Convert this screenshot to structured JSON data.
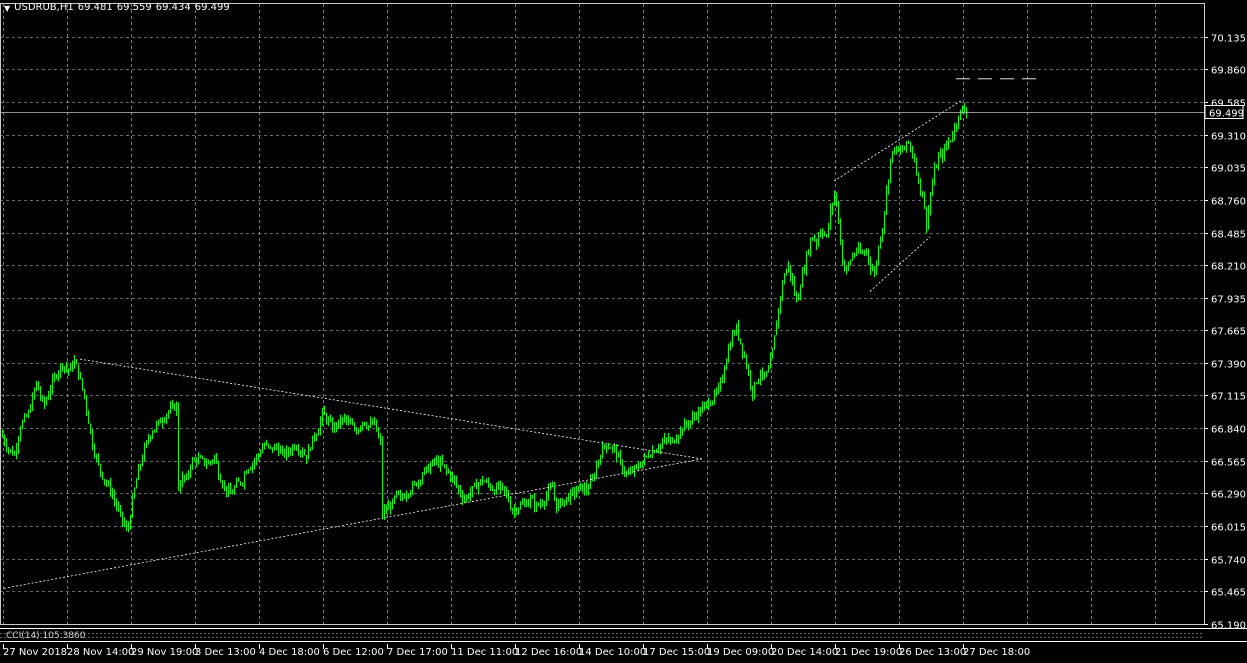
{
  "header": {
    "symbol": "USDRUB,H1",
    "open": "69.481",
    "high": "69.559",
    "low": "69.434",
    "close": "69.499"
  },
  "current_price": "69.499",
  "indicator_label": "CCI(14) 105.3860",
  "colors": {
    "background": "#000000",
    "grid": "#c8c8c8",
    "candle": "#00ff00",
    "price_line": "#c0c0c0",
    "trendline": "#ffffff",
    "text": "#ffffff"
  },
  "chart_data": {
    "type": "candlestick",
    "symbol": "USDRUB",
    "timeframe": "H1",
    "ylim": [
      65.19,
      70.41
    ],
    "y_ticks": [
      "70.135",
      "69.860",
      "69.585",
      "69.310",
      "69.035",
      "68.760",
      "68.485",
      "68.210",
      "67.935",
      "67.665",
      "67.390",
      "67.115",
      "66.840",
      "66.565",
      "66.290",
      "66.015",
      "65.740",
      "65.465",
      "65.190"
    ],
    "x_ticks": [
      "27 Nov 2018",
      "28 Nov 14:00",
      "29 Nov 19:00",
      "3 Dec 13:00",
      "4 Dec 18:00",
      "6 Dec 12:00",
      "7 Dec 17:00",
      "11 Dec 11:00",
      "12 Dec 16:00",
      "14 Dec 10:00",
      "17 Dec 15:00",
      "19 Dec 09:00",
      "20 Dec 14:00",
      "21 Dec 19:00",
      "26 Dec 13:00",
      "27 Dec 18:00"
    ],
    "grid": true,
    "close_path": [
      [
        0,
        66.8
      ],
      [
        8,
        66.66
      ],
      [
        14,
        66.62
      ],
      [
        20,
        66.86
      ],
      [
        28,
        66.96
      ],
      [
        36,
        67.22
      ],
      [
        43,
        67.02
      ],
      [
        50,
        67.18
      ],
      [
        56,
        67.3
      ],
      [
        62,
        67.38
      ],
      [
        68,
        67.32
      ],
      [
        74,
        67.4
      ],
      [
        78,
        67.3
      ],
      [
        84,
        67.1
      ],
      [
        88,
        66.9
      ],
      [
        92,
        66.7
      ],
      [
        98,
        66.52
      ],
      [
        104,
        66.4
      ],
      [
        110,
        66.32
      ],
      [
        116,
        66.18
      ],
      [
        122,
        66.06
      ],
      [
        127,
        65.96
      ],
      [
        130,
        66.12
      ],
      [
        134,
        66.32
      ],
      [
        138,
        66.48
      ],
      [
        144,
        66.66
      ],
      [
        150,
        66.8
      ],
      [
        156,
        66.86
      ],
      [
        162,
        66.92
      ],
      [
        168,
        66.98
      ],
      [
        174,
        67.02
      ],
      [
        178,
        66.34
      ],
      [
        182,
        66.42
      ],
      [
        186,
        66.4
      ],
      [
        190,
        66.54
      ],
      [
        196,
        66.58
      ],
      [
        202,
        66.56
      ],
      [
        208,
        66.54
      ],
      [
        214,
        66.6
      ],
      [
        218,
        66.46
      ],
      [
        224,
        66.34
      ],
      [
        230,
        66.28
      ],
      [
        236,
        66.36
      ],
      [
        242,
        66.4
      ],
      [
        246,
        66.5
      ],
      [
        252,
        66.54
      ],
      [
        258,
        66.62
      ],
      [
        264,
        66.7
      ],
      [
        270,
        66.66
      ],
      [
        276,
        66.68
      ],
      [
        282,
        66.62
      ],
      [
        288,
        66.64
      ],
      [
        294,
        66.7
      ],
      [
        300,
        66.66
      ],
      [
        306,
        66.6
      ],
      [
        312,
        66.74
      ],
      [
        318,
        66.84
      ],
      [
        322,
        66.96
      ],
      [
        326,
        66.92
      ],
      [
        332,
        66.84
      ],
      [
        338,
        66.88
      ],
      [
        344,
        66.92
      ],
      [
        350,
        66.86
      ],
      [
        356,
        66.82
      ],
      [
        362,
        66.9
      ],
      [
        368,
        66.86
      ],
      [
        374,
        66.88
      ],
      [
        379,
        66.72
      ],
      [
        381,
        66.1
      ],
      [
        386,
        66.16
      ],
      [
        392,
        66.2
      ],
      [
        396,
        66.28
      ],
      [
        400,
        66.24
      ],
      [
        406,
        66.3
      ],
      [
        412,
        66.34
      ],
      [
        418,
        66.4
      ],
      [
        422,
        66.46
      ],
      [
        428,
        66.5
      ],
      [
        434,
        66.56
      ],
      [
        440,
        66.54
      ],
      [
        446,
        66.48
      ],
      [
        452,
        66.42
      ],
      [
        458,
        66.32
      ],
      [
        464,
        66.24
      ],
      [
        470,
        66.3
      ],
      [
        476,
        66.36
      ],
      [
        482,
        66.4
      ],
      [
        488,
        66.36
      ],
      [
        494,
        66.32
      ],
      [
        500,
        66.34
      ],
      [
        506,
        66.28
      ],
      [
        512,
        66.14
      ],
      [
        518,
        66.18
      ],
      [
        524,
        66.2
      ],
      [
        530,
        66.24
      ],
      [
        536,
        66.18
      ],
      [
        542,
        66.22
      ],
      [
        548,
        66.3
      ],
      [
        552,
        66.34
      ],
      [
        556,
        66.18
      ],
      [
        562,
        66.22
      ],
      [
        568,
        66.26
      ],
      [
        574,
        66.3
      ],
      [
        580,
        66.34
      ],
      [
        586,
        66.32
      ],
      [
        592,
        66.4
      ],
      [
        598,
        66.58
      ],
      [
        604,
        66.7
      ],
      [
        610,
        66.68
      ],
      [
        614,
        66.66
      ],
      [
        618,
        66.58
      ],
      [
        622,
        66.5
      ],
      [
        628,
        66.44
      ],
      [
        632,
        66.48
      ],
      [
        636,
        66.5
      ],
      [
        642,
        66.56
      ],
      [
        648,
        66.62
      ],
      [
        654,
        66.66
      ],
      [
        660,
        66.7
      ],
      [
        666,
        66.74
      ],
      [
        672,
        66.72
      ],
      [
        678,
        66.8
      ],
      [
        684,
        66.86
      ],
      [
        690,
        66.9
      ],
      [
        696,
        66.96
      ],
      [
        702,
        67.0
      ],
      [
        708,
        67.06
      ],
      [
        714,
        67.1
      ],
      [
        720,
        67.2
      ],
      [
        726,
        67.44
      ],
      [
        732,
        67.62
      ],
      [
        736,
        67.68
      ],
      [
        740,
        67.56
      ],
      [
        744,
        67.44
      ],
      [
        748,
        67.3
      ],
      [
        752,
        67.14
      ],
      [
        756,
        67.24
      ],
      [
        760,
        67.3
      ],
      [
        764,
        67.26
      ],
      [
        768,
        67.32
      ],
      [
        772,
        67.48
      ],
      [
        776,
        67.72
      ],
      [
        780,
        67.96
      ],
      [
        784,
        68.14
      ],
      [
        788,
        68.2
      ],
      [
        792,
        68.06
      ],
      [
        796,
        67.9
      ],
      [
        800,
        68.06
      ],
      [
        804,
        68.2
      ],
      [
        808,
        68.36
      ],
      [
        812,
        68.46
      ],
      [
        816,
        68.4
      ],
      [
        820,
        68.52
      ],
      [
        826,
        68.44
      ],
      [
        830,
        68.66
      ],
      [
        834,
        68.82
      ],
      [
        838,
        68.6
      ],
      [
        842,
        68.24
      ],
      [
        846,
        68.16
      ],
      [
        850,
        68.26
      ],
      [
        856,
        68.34
      ],
      [
        862,
        68.3
      ],
      [
        866,
        68.34
      ],
      [
        870,
        68.2
      ],
      [
        874,
        68.14
      ],
      [
        878,
        68.36
      ],
      [
        882,
        68.54
      ],
      [
        886,
        68.82
      ],
      [
        890,
        69.1
      ],
      [
        894,
        69.2
      ],
      [
        898,
        69.16
      ],
      [
        902,
        69.18
      ],
      [
        908,
        69.24
      ],
      [
        914,
        69.1
      ],
      [
        918,
        68.92
      ],
      [
        922,
        68.8
      ],
      [
        926,
        68.56
      ],
      [
        930,
        68.8
      ],
      [
        934,
        69.0
      ],
      [
        938,
        69.12
      ],
      [
        942,
        69.14
      ],
      [
        946,
        69.22
      ],
      [
        950,
        69.28
      ],
      [
        954,
        69.36
      ],
      [
        958,
        69.48
      ],
      [
        962,
        69.52
      ],
      [
        966,
        69.5
      ]
    ]
  }
}
